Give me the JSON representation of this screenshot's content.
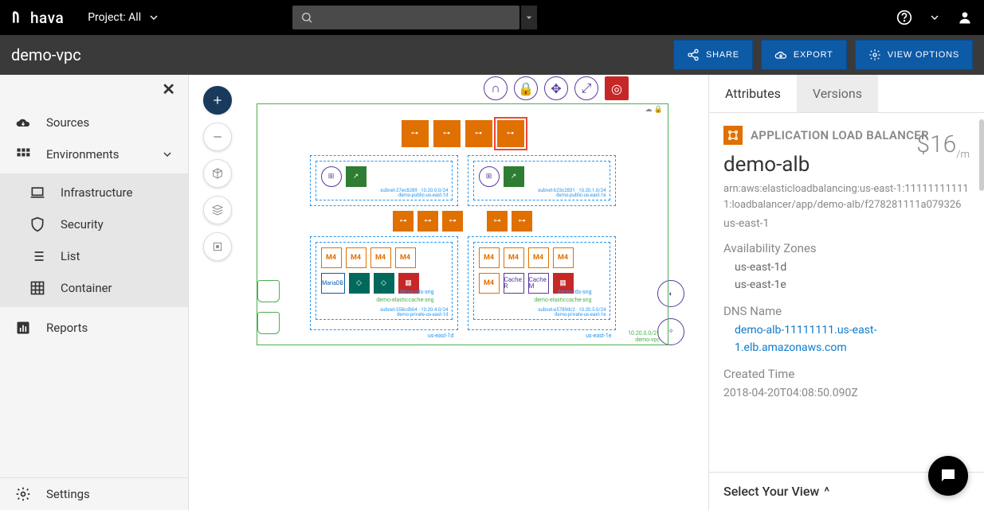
{
  "topbar": {
    "logo": "hava",
    "project_label": "Project: All",
    "search_placeholder": ""
  },
  "subheader": {
    "title": "demo-vpc",
    "share": "SHARE",
    "export": "EXPORT",
    "view_options": "VIEW OPTIONS"
  },
  "sidebar": {
    "sources": "Sources",
    "environments": "Environments",
    "infrastructure": "Infrastructure",
    "security": "Security",
    "list": "List",
    "container": "Container",
    "reports": "Reports",
    "settings": "Settings"
  },
  "diagram": {
    "vpc_cidr": "10.20.0.0/21",
    "vpc_name": "demo-vpc",
    "azs": [
      {
        "name": "us-east-1d",
        "public_subnet": {
          "id": "subnet-27ec8289",
          "cidr": "10.20.0.0/24",
          "name": "demo-public-us-east-1d"
        },
        "private_subnet": {
          "id": "subnet-558cdb04",
          "cidr": "10.20.4.0/24",
          "name": "demo-private-us-east-1d"
        },
        "rds_sng": "demo-rds-sng",
        "cache_sng": "demo-elasticcache-sng"
      },
      {
        "name": "us-east-1e",
        "public_subnet": {
          "id": "subnet-b23c2831",
          "cidr": "10.20.1.0/24",
          "name": "demo-public-us-east-1e"
        },
        "private_subnet": {
          "id": "subnet-e5789dc2",
          "cidr": "10.20.5.0/24",
          "name": "demo-private-us-east-1e"
        },
        "rds_sng": "demo-rds-sng",
        "cache_sng": "demo-elasticcache-sng"
      }
    ],
    "instance_label": "M4",
    "mariadb": "MariaDB",
    "cache_r": "Cache R",
    "cache_m": "Cache M"
  },
  "right_panel": {
    "tab_attributes": "Attributes",
    "tab_versions": "Versions",
    "resource_type": "APPLICATION LOAD BALANCER",
    "resource_name": "demo-alb",
    "arn": "arn:aws:elasticloadbalancing:us-east-1:111111111111:loadbalancer/app/demo-alb/f278281111a079326",
    "price": "$16",
    "price_unit": "/m",
    "region": "us-east-1",
    "az_label": "Availability Zones",
    "az1": "us-east-1d",
    "az2": "us-east-1e",
    "dns_label": "DNS Name",
    "dns": "demo-alb-11111111.us-east-1.elb.amazonaws.com",
    "created_label": "Created Time",
    "created": "2018-04-20T04:08:50.090Z",
    "select_view": "Select Your View"
  }
}
